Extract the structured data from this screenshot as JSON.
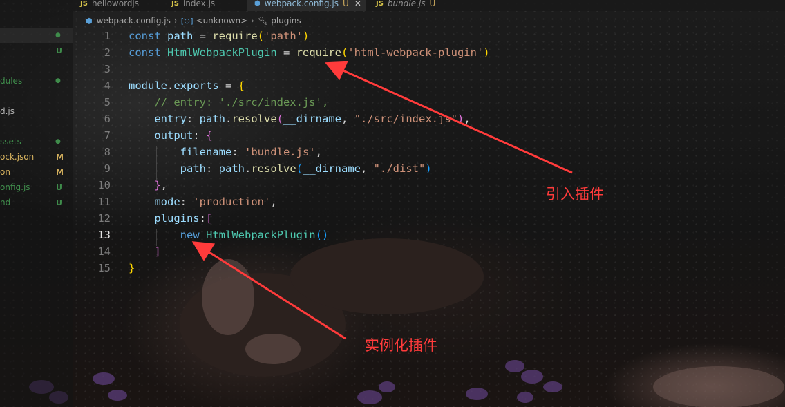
{
  "tabs": [
    {
      "icon": "JS",
      "name": "hellowordjs",
      "active": false
    },
    {
      "icon": "JS",
      "name": "index.js",
      "active": false
    },
    {
      "icon": "gear",
      "name": "webpack.config.js",
      "status": "U",
      "active": true
    },
    {
      "icon": "JS",
      "name": "bundle.js",
      "status": "U",
      "active": false
    }
  ],
  "breadcrumb": {
    "file": "webpack.config.js",
    "symbol1": "<unknown>",
    "symbol2": "plugins"
  },
  "explorer": {
    "items": [
      {
        "label": "",
        "badge": "●",
        "color": "#3f8c4b"
      },
      {
        "label": "",
        "badge": "U",
        "color": "#3f8c4b"
      },
      {
        "label": "dules",
        "badge": "●",
        "color": "#3f8c4b"
      },
      {
        "label": "d.js",
        "badge": "",
        "color": "#b5b5b5"
      },
      {
        "label": "ssets",
        "badge": "●",
        "color": "#3f8c4b"
      },
      {
        "label": "ock.json",
        "badge": "M",
        "color": "#d6b25e"
      },
      {
        "label": "on",
        "badge": "M",
        "color": "#d6b25e"
      },
      {
        "label": "onfig.js",
        "badge": "U",
        "color": "#3f8c4b"
      },
      {
        "label": "nd",
        "badge": "U",
        "color": "#3f8c4b"
      }
    ]
  },
  "code": {
    "current_line": 13,
    "line_numbers": [
      "1",
      "2",
      "3",
      "4",
      "5",
      "6",
      "7",
      "8",
      "9",
      "10",
      "11",
      "12",
      "13",
      "14",
      "15"
    ],
    "lines": [
      "const path = require('path')",
      "const HtmlWebpackPlugin = require('html-webpack-plugin')",
      "",
      "module.exports = {",
      "    // entry: './src/index.js',",
      "    entry: path.resolve(__dirname, \"./src/index.js\"),",
      "    output: {",
      "        filename: 'bundle.js',",
      "        path: path.resolve(__dirname, \"./dist\")",
      "    },",
      "    mode: 'production',",
      "    plugins:[",
      "        new HtmlWebpackPlugin()",
      "    ]",
      "}"
    ]
  },
  "annotations": {
    "import_plugin": "引入插件",
    "instantiate_plugin": "实例化插件",
    "color": "#ff3b3b"
  }
}
